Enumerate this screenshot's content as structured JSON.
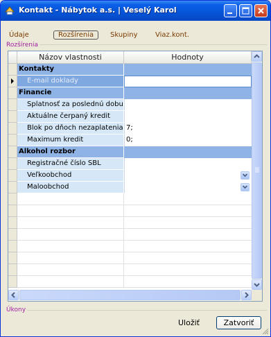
{
  "window": {
    "title": "Kontakt - Nábytok a.s. | Veselý Karol"
  },
  "tabs": [
    {
      "label": "Údaje"
    },
    {
      "label": "Rozšírenia"
    },
    {
      "label": "Skupiny"
    },
    {
      "label": "Viaz.kont."
    }
  ],
  "active_tab": "Rozšírenia",
  "group_label": "Rozšírenia",
  "grid": {
    "headers": {
      "name": "Názov vlastnosti",
      "value": "Hodnoty"
    },
    "rows": [
      {
        "type": "group",
        "name": "Kontakty",
        "value": ""
      },
      {
        "type": "prop",
        "name": "E-mail doklady",
        "value": "",
        "selected": true
      },
      {
        "type": "group",
        "name": "Financie",
        "value": ""
      },
      {
        "type": "prop",
        "name": "Splatnosť za poslednú dobu",
        "value": ""
      },
      {
        "type": "prop",
        "name": "Aktuálne čerpaný kredit",
        "value": ""
      },
      {
        "type": "prop",
        "name": "Blok po dňoch nezaplatenia",
        "value": "7;"
      },
      {
        "type": "prop",
        "name": "Maximum kredit",
        "value": "0;"
      },
      {
        "type": "group",
        "name": "Alkohol rozbor",
        "value": ""
      },
      {
        "type": "prop",
        "name": "Registračné číslo SBL",
        "value": ""
      },
      {
        "type": "prop",
        "name": "Veľkoobchod",
        "value": "",
        "dropdown": true
      },
      {
        "type": "prop",
        "name": "Maloobchod",
        "value": "",
        "dropdown": true
      }
    ]
  },
  "actions": {
    "label": "Úkony",
    "save_label": "Uložiť",
    "close_label": "Zatvoriť"
  },
  "colors": {
    "title_bar": "#0654d8",
    "group_row": "#8fb3e4",
    "name_cell": "#d6e8f7",
    "tab_text": "#7a3a00",
    "section_label": "#a020a0"
  }
}
